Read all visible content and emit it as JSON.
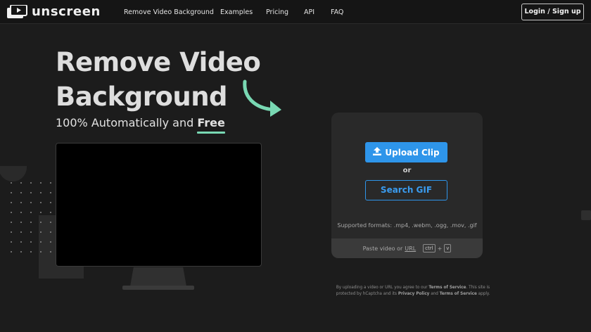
{
  "brand": {
    "name": "unscreen"
  },
  "nav": {
    "links": [
      "Remove Video Background",
      "Examples",
      "Pricing",
      "API",
      "FAQ"
    ],
    "login_label": "Login / Sign up"
  },
  "hero": {
    "title": "Remove Video Background",
    "subtitle_prefix": "100% Automatically and ",
    "subtitle_emphasis": "Free"
  },
  "upload": {
    "upload_label": "Upload Clip",
    "or_label": "or",
    "search_label": "Search GIF",
    "formats_text": "Supported formats: .mp4, .webm, .ogg, .mov, .gif",
    "paste_prefix": "Paste video or",
    "paste_url": "URL",
    "key_ctrl": "ctrl",
    "key_plus": "+",
    "key_v": "v"
  },
  "legal": {
    "t1": "By uploading a video or URL you agree to our ",
    "tos": "Terms of Service",
    "t2": ". This site is protected by hCaptcha and its ",
    "privacy": "Privacy Policy",
    "t3": " and ",
    "tos2": "Terms of Service",
    "t4": " apply."
  },
  "colors": {
    "accent_blue": "#2e95ea",
    "accent_green": "#79d8b3",
    "background": "#1c1c1c"
  },
  "icons": [
    "unscreen-logo-icon",
    "upload-icon",
    "curved-arrow-icon"
  ]
}
